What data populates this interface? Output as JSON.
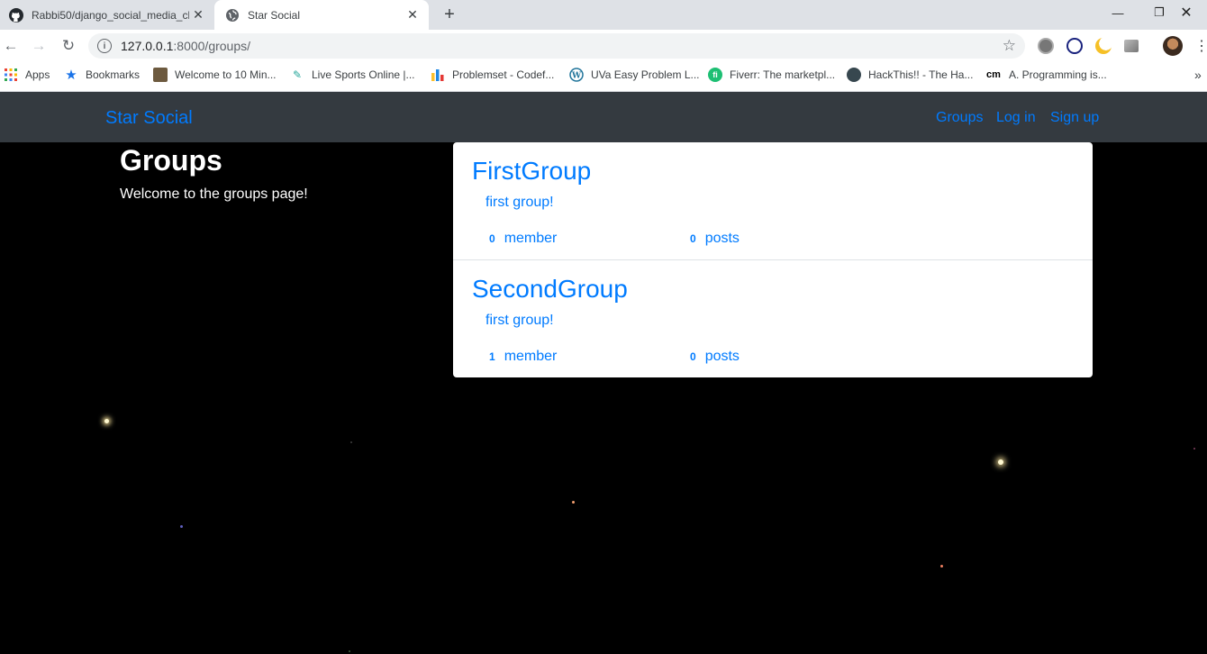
{
  "browser": {
    "tabs": [
      {
        "title": "Rabbi50/django_social_media_cl",
        "icon": "github-icon"
      },
      {
        "title": "Star Social",
        "icon": "globe-icon",
        "active": true
      }
    ],
    "url_host": "127.0.0.1",
    "url_rest": ":8000/groups/",
    "bookmarks": [
      {
        "label": "Apps",
        "icon": "apps-grid-icon"
      },
      {
        "label": "Bookmarks",
        "icon": "star-icon"
      },
      {
        "label": "Welcome to 10 Min...",
        "icon": "site-icon"
      },
      {
        "label": "Live Sports Online |...",
        "icon": "pin-icon"
      },
      {
        "label": "Problemset - Codef...",
        "icon": "bars-chart-icon"
      },
      {
        "label": "UVa Easy Problem L...",
        "icon": "wordpress-icon"
      },
      {
        "label": "Fiverr: The marketpl...",
        "icon": "fiverr-icon"
      },
      {
        "label": "HackThis!! - The Ha...",
        "icon": "hackthis-icon"
      },
      {
        "label": "A. Programming is...",
        "icon": "cm-icon"
      }
    ],
    "cm_icon_text": "cm",
    "overflow": "»"
  },
  "navbar": {
    "brand": "Star Social",
    "links": [
      "Groups",
      "Log in",
      "Sign up"
    ]
  },
  "page": {
    "title": "Groups",
    "subtitle": "Welcome to the groups page!"
  },
  "groups": [
    {
      "name": "FirstGroup",
      "description": "first group!",
      "members": "0",
      "member_label": "member",
      "posts": "0",
      "posts_label": "posts"
    },
    {
      "name": "SecondGroup",
      "description": "first group!",
      "members": "1",
      "member_label": "member",
      "posts": "0",
      "posts_label": "posts"
    }
  ],
  "colors": {
    "link": "#007bff",
    "navbar": "#343a40",
    "background": "#000000"
  }
}
